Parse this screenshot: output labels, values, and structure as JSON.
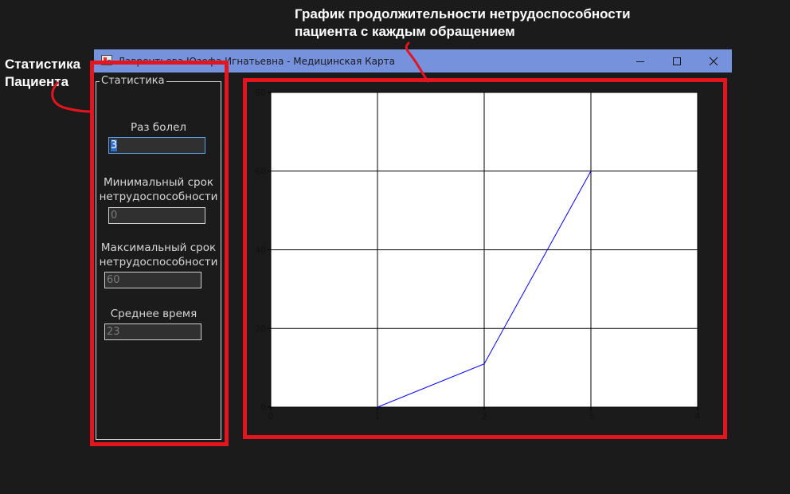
{
  "window": {
    "title": "Лаврентьева Юзефа Игнатьевна - Медицинская Карта",
    "minimize_icon": "minimize-icon",
    "maximize_icon": "maximize-icon",
    "close_icon": "close-icon",
    "titlebar_color": "#7792dd"
  },
  "annotations": {
    "stats_label_lines": [
      "Статистика",
      "Пациента"
    ],
    "chart_label_lines": [
      "График продолжительности нетрудоспособности",
      "пациента с каждым обращением"
    ],
    "highlight_color": "#e3151f"
  },
  "stats": {
    "group_title": "Статистика",
    "times_sick_label": "Раз болел",
    "times_sick_value": "3",
    "min_label_lines": [
      "Минимальный срок",
      "нетрудоспособности"
    ],
    "min_value": "0",
    "max_label_lines": [
      "Максимальный срок",
      "нетрудоспособности"
    ],
    "max_value": "60",
    "avg_label": "Среднее время",
    "avg_value": "23"
  },
  "chart_data": {
    "type": "line",
    "x": [
      1,
      2,
      3
    ],
    "y": [
      0,
      11,
      60
    ],
    "xlim": [
      0,
      4
    ],
    "ylim": [
      0,
      80
    ],
    "x_ticks": [
      "0",
      "1",
      "2",
      "3",
      "4"
    ],
    "y_ticks": [
      "0",
      "20",
      "40",
      "60",
      "80"
    ],
    "grid": true,
    "line_color": "#0000ff"
  }
}
